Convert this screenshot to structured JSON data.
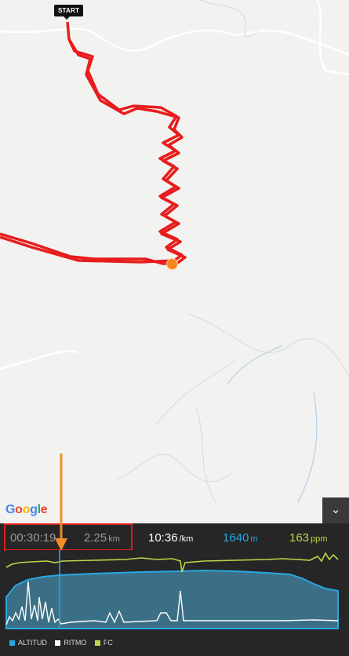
{
  "map": {
    "start_label": "START",
    "route_color": "#e81c1c",
    "marker_color": "#f7861c",
    "provider": "Google"
  },
  "stats": {
    "elapsed_time": "00:30:19",
    "distance": "2.25",
    "distance_unit": "km",
    "pace": "10:36",
    "pace_unit": "/km",
    "altitude": "1640",
    "altitude_unit": "m",
    "heart_rate": "163",
    "heart_rate_unit": "ppm"
  },
  "colors": {
    "altitude": "#2aa7e2",
    "pace": "#ffffff",
    "heart_rate": "#b8d84a",
    "highlight": "#e01b1b",
    "arrow": "#f28c28"
  },
  "legend": [
    {
      "label": "ALTITUD",
      "color": "#2aa7e2"
    },
    {
      "label": "RITMO",
      "color": "#ffffff"
    },
    {
      "label": "FC",
      "color": "#b8d84a"
    }
  ],
  "icons": {
    "collapse": "chevron-down-icon"
  }
}
